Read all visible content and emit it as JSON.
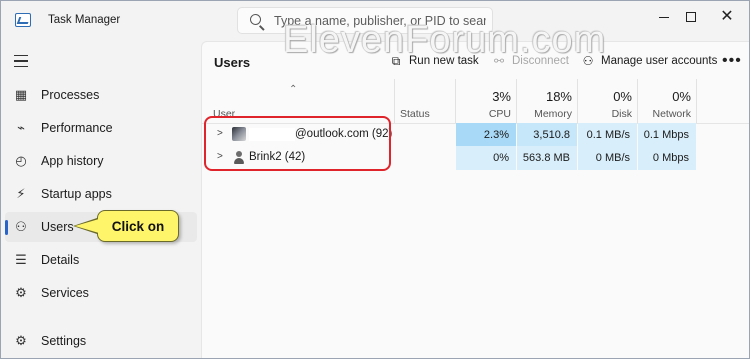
{
  "window": {
    "title": "Task Manager",
    "search_placeholder": "Type a name, publisher, or PID to search",
    "watermark": "ElevenForum.com"
  },
  "sidebar": {
    "items": [
      {
        "label": "Processes",
        "icon": "processes-icon"
      },
      {
        "label": "Performance",
        "icon": "performance-icon"
      },
      {
        "label": "App history",
        "icon": "app-history-icon"
      },
      {
        "label": "Startup apps",
        "icon": "startup-apps-icon"
      },
      {
        "label": "Users",
        "icon": "users-icon",
        "selected": true
      },
      {
        "label": "Details",
        "icon": "details-icon"
      },
      {
        "label": "Services",
        "icon": "services-icon"
      }
    ],
    "settings_label": "Settings"
  },
  "main": {
    "title": "Users",
    "toolbar": {
      "run_new_task": "Run new task",
      "disconnect": "Disconnect",
      "manage_user_accounts": "Manage user accounts",
      "more": "•••"
    },
    "columns": {
      "user": "User",
      "status": "Status",
      "cpu_pct": "3%",
      "cpu": "CPU",
      "memory_pct": "18%",
      "memory": "Memory",
      "disk_pct": "0%",
      "disk": "Disk",
      "network_pct": "0%",
      "network": "Network"
    },
    "rows": [
      {
        "name": "@outlook.com (92)",
        "status": "",
        "cpu": "2.3%",
        "memory": "3,510.8 MB",
        "disk": "0.1 MB/s",
        "network": "0.1 Mbps"
      },
      {
        "name": "Brink2 (42)",
        "status": "",
        "cpu": "0%",
        "memory": "563.8 MB",
        "disk": "0 MB/s",
        "network": "0 Mbps"
      }
    ]
  },
  "callout": {
    "text": "Click on",
    "color": "#fff56b"
  },
  "colors": {
    "accent": "#2864c8",
    "highlight": "#e0242b"
  }
}
